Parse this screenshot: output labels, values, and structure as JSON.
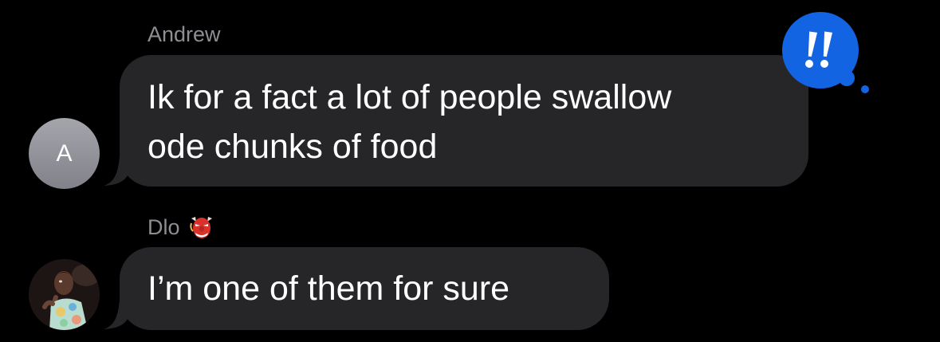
{
  "conversation": {
    "messages": [
      {
        "sender": "Andrew",
        "avatar_initial": "A",
        "lines": [
          "Ik for a fact a lot of people swallow",
          "ode chunks of food"
        ],
        "tapback": {
          "icon": "exclamation-icon",
          "glyph": "!!",
          "color": "#1264e3"
        }
      },
      {
        "sender": "Dlo",
        "sender_emoji": "goblin-mask-emoji",
        "avatar": "profile-photo",
        "text": "I’m one of them for sure"
      }
    ]
  },
  "colors": {
    "background": "#000000",
    "bubble": "#262629",
    "sender_name": "#8e8e93",
    "tapback": "#1264e3"
  }
}
